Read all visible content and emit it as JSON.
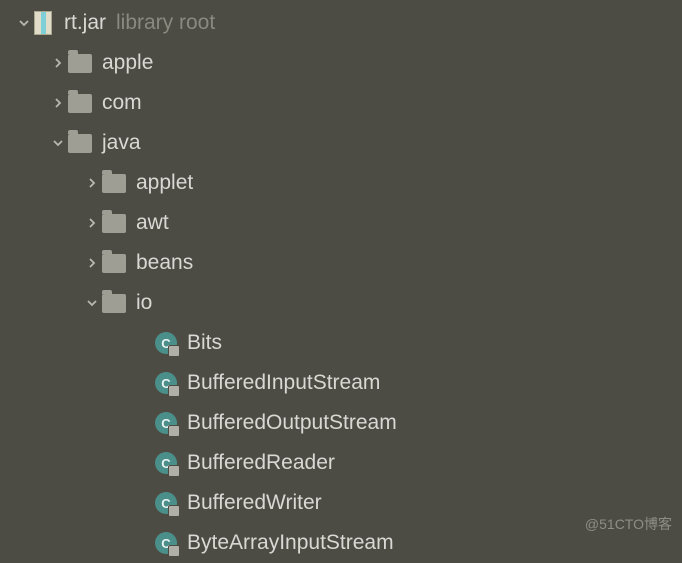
{
  "root": {
    "name": "rt.jar",
    "suffix": "library root"
  },
  "packages": {
    "apple": "apple",
    "com": "com",
    "java": "java"
  },
  "java_sub": {
    "applet": "applet",
    "awt": "awt",
    "beans": "beans",
    "io": "io"
  },
  "io_classes": [
    "Bits",
    "BufferedInputStream",
    "BufferedOutputStream",
    "BufferedReader",
    "BufferedWriter",
    "ByteArrayInputStream"
  ],
  "class_glyph": "C",
  "watermark": "@51CTO博客"
}
